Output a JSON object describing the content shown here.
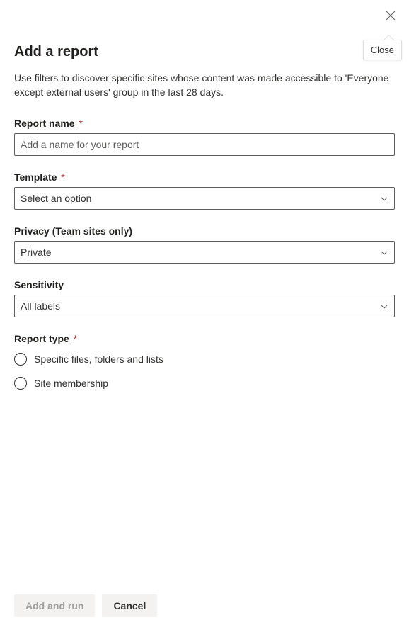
{
  "header": {
    "close_tooltip": "Close"
  },
  "panel": {
    "title": "Add a report",
    "description": "Use filters to discover specific sites whose content was made accessible to 'Everyone except external users' group in the last 28 days."
  },
  "fields": {
    "report_name": {
      "label": "Report name",
      "required": true,
      "placeholder": "Add a name for your report",
      "value": ""
    },
    "template": {
      "label": "Template",
      "required": true,
      "selected": "Select an option"
    },
    "privacy": {
      "label": "Privacy (Team sites only)",
      "required": false,
      "selected": "Private"
    },
    "sensitivity": {
      "label": "Sensitivity",
      "required": false,
      "selected": "All labels"
    },
    "report_type": {
      "label": "Report type",
      "required": true,
      "options": [
        {
          "label": "Specific files, folders and lists"
        },
        {
          "label": "Site membership"
        }
      ]
    }
  },
  "footer": {
    "primary_label": "Add and run",
    "secondary_label": "Cancel"
  },
  "required_marker": "*"
}
